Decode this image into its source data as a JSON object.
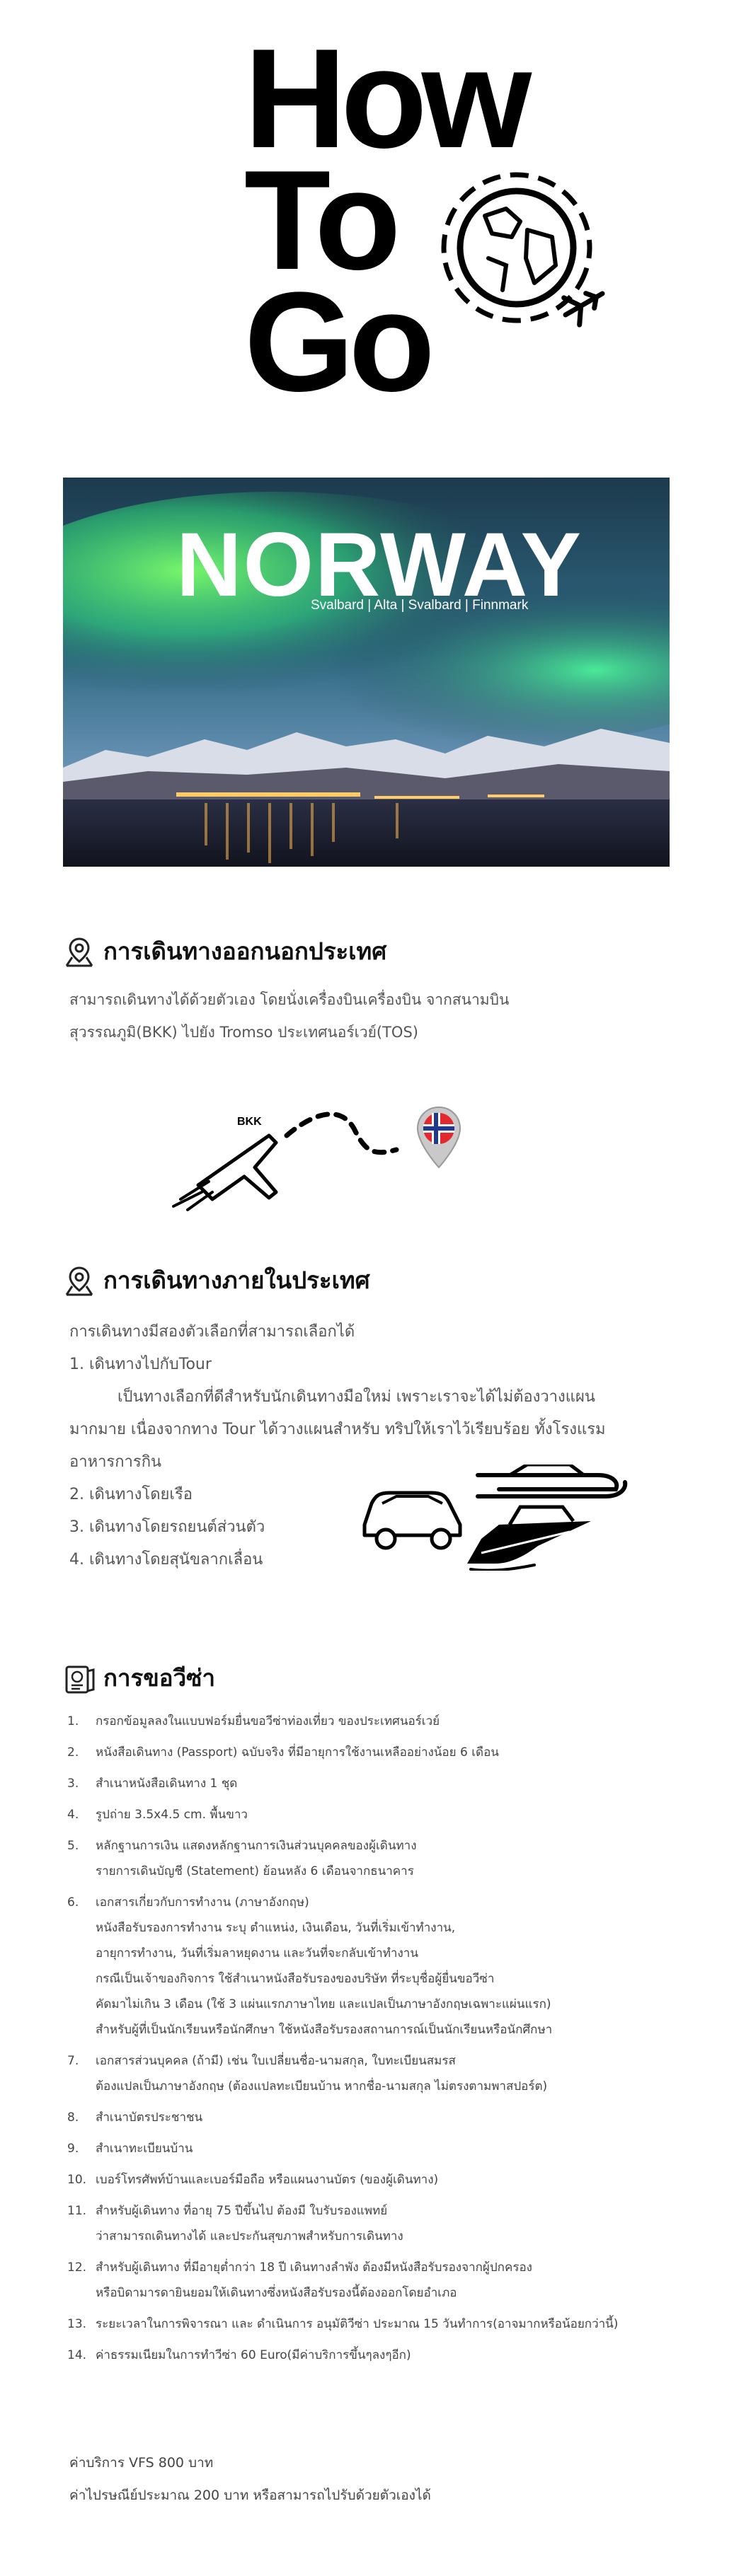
{
  "hero": {
    "line1": "How",
    "line2": "To",
    "line3": "Go"
  },
  "banner": {
    "title": "NORWAY",
    "subtitle": "Svalbard | Alta | Svalbard | Finnmark"
  },
  "section1": {
    "heading": "การเดินทางออกนอกประเทศ",
    "line1": "สามารถเดินทางได้ด้วยตัวเอง โดยนั่งเครื่องบินเครื่องบิน จากสนามบิน",
    "line2": "สุวรรณภูมิ(BKK) ไปยัง Tromso ประเทศนอร์เวย์(TOS)",
    "plane_label": "BKK"
  },
  "section2": {
    "heading": "การเดินทางภายในประเทศ",
    "intro": "การเดินทางมีสองตัวเลือกที่สามารถเลือกได้",
    "item1": "1. เดินทางไปกับTour",
    "desc1": "เป็นทางเลือกที่ดีสำหรับนักเดินทางมือใหม่ เพราะเราจะได้ไม่ต้องวางแผน",
    "desc2": "มากมาย เนื่องจากทาง Tour ได้วางแผนสำหรับ ทริปให้เราไว้เรียบร้อย ทั้งโรงแรม",
    "desc3": "อาหารการกิน",
    "item2": "2. เดินทางโดยเรือ",
    "item3": "3. เดินทางโดยรถยนต์ส่วนตัว",
    "item4": "4. เดินทางโดยสุนัขลากเลื่อน"
  },
  "section3": {
    "heading": "การขอวีซ่า",
    "items": [
      {
        "num": "1.",
        "lines": [
          "กรอกข้อมูลลงในแบบฟอร์มยื่นขอวีซ่าท่องเที่ยว ของประเทศนอร์เวย์"
        ]
      },
      {
        "num": "2.",
        "lines": [
          "หนังสือเดินทาง (Passport) ฉบับจริง ที่มีอายุการใช้งานเหลืออย่างน้อย 6 เดือน"
        ]
      },
      {
        "num": "3.",
        "lines": [
          "สำเนาหนังสือเดินทาง 1 ชุด"
        ]
      },
      {
        "num": "4.",
        "lines": [
          "รูปถ่าย 3.5x4.5 cm. พื้นขาว"
        ]
      },
      {
        "num": "5.",
        "lines": [
          "หลักฐานการเงิน แสดงหลักฐานการเงินส่วนบุคคลของผู้เดินทาง",
          "รายการเดินบัญชี (Statement) ย้อนหลัง 6 เดือนจากธนาคาร"
        ]
      },
      {
        "num": "6.",
        "lines": [
          "เอกสารเกี่ยวกับการทำงาน (ภาษาอังกฤษ)",
          "หนังสือรับรองการทำงาน ระบุ ตำแหน่ง, เงินเดือน, วันที่เริ่มเข้าทำงาน,",
          "อายุการทำงาน, วันที่เริ่มลาหยุดงาน และวันที่จะกลับเข้าทำงาน",
          "กรณีเป็นเจ้าของกิจการ ใช้สำเนาหนังสือรับรองของบริษัท ที่ระบุชื่อผู้ยื่นขอวีซ่า",
          "คัดมาไม่เกิน 3 เดือน (ใช้ 3 แผ่นแรกภาษาไทย และแปลเป็นภาษาอังกฤษเฉพาะแผ่นแรก)",
          "สำหรับผู้ที่เป็นนักเรียนหรือนักศึกษา ใช้หนังสือรับรองสถานการณ์เป็นนักเรียนหรือนักศึกษา"
        ]
      },
      {
        "num": "7.",
        "lines": [
          "เอกสารส่วนบุคคล (ถ้ามี) เช่น ใบเปลี่ยนชื่อ-นามสกุล, ใบทะเบียนสมรส",
          "ต้องแปลเป็นภาษาอังกฤษ (ต้องแปลทะเบียนบ้าน หากชื่อ-นามสกุล ไม่ตรงตามพาสปอร์ต)"
        ]
      },
      {
        "num": "8.",
        "lines": [
          "สำเนาบัตรประชาชน"
        ]
      },
      {
        "num": "9.",
        "lines": [
          "สำเนาทะเบียนบ้าน"
        ]
      },
      {
        "num": "10.",
        "lines": [
          "เบอร์โทรศัพท์บ้านและเบอร์มือถือ หรือแผนงานบัตร (ของผู้เดินทาง)"
        ]
      },
      {
        "num": "11.",
        "lines": [
          "สำหรับผู้เดินทาง ที่อายุ 75 ปีขึ้นไป ต้องมี ใบรับรองแพทย์",
          "ว่าสามารถเดินทางได้ และประกันสุขภาพสำหรับการเดินทาง"
        ]
      },
      {
        "num": "12.",
        "lines": [
          "สำหรับผู้เดินทาง ที่มีอายุต่ำกว่า 18 ปี เดินทางลำพัง ต้องมีหนังสือรับรองจากผู้ปกครอง",
          "หรือบิดามารดายินยอมให้เดินทางซึ่งหนังสือรับรองนี้ต้องออกโดยอำเภอ"
        ]
      },
      {
        "num": "13.",
        "lines": [
          "ระยะเวลาในการพิจารณา และ ดำเนินการ อนุมัติวีซ่า ประมาณ 15 วันทำการ(อาจมากหรือน้อยกว่านี้)"
        ]
      },
      {
        "num": "14.",
        "lines": [
          "ค่าธรรมเนียมในการทำวีซ่า 60 Euro(มีค่าบริการขึ้นๆลงๆอีก)"
        ]
      }
    ],
    "fee1": "ค่าบริการ VFS  800 บาท",
    "fee2": "ค่าไปรษณีย์ประมาณ 200 บาท หรือสามารถไปรับด้วยตัวเองได้"
  }
}
